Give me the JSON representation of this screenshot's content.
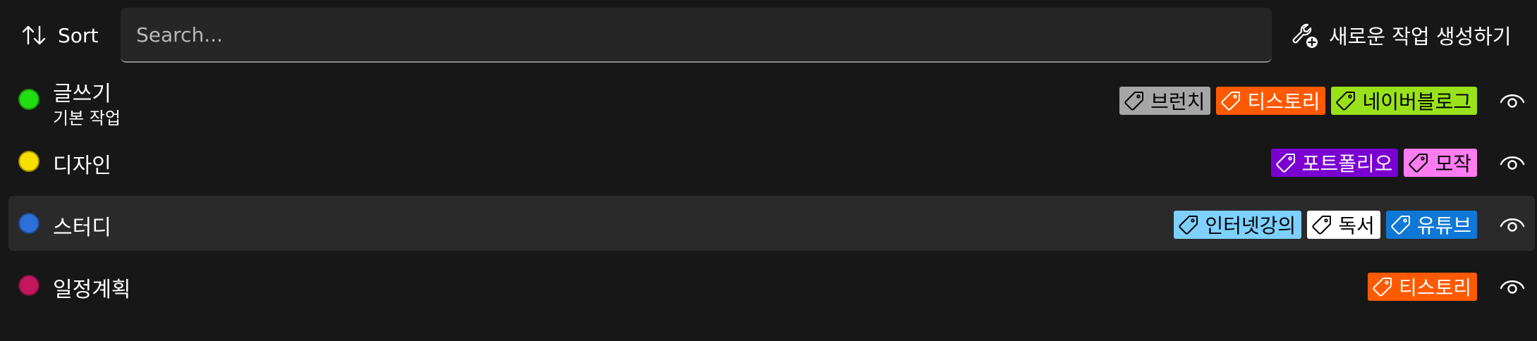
{
  "toolbar": {
    "sort_label": "Sort",
    "search_placeholder": "Search...",
    "search_value": "",
    "new_task_label": "새로운 작업 생성하기",
    "sort_icon": "sort-arrows-icon",
    "new_task_icon": "wrench-add-icon"
  },
  "tasks": [
    {
      "name": "글쓰기",
      "subtitle": "기본 작업",
      "color": "#22dd11",
      "highlighted": false,
      "tags": [
        {
          "label": "브런치",
          "bg": "#a6a6a6",
          "fg": "#000000"
        },
        {
          "label": "티스토리",
          "bg": "#ff5a00",
          "fg": "#ffffff"
        },
        {
          "label": "네이버블로그",
          "bg": "#99e21a",
          "fg": "#000000"
        }
      ]
    },
    {
      "name": "디자인",
      "subtitle": "",
      "color": "#f7e000",
      "highlighted": false,
      "tags": [
        {
          "label": "포트폴리오",
          "bg": "#7a00d2",
          "fg": "#ffffff"
        },
        {
          "label": "모작",
          "bg": "#ff7cf0",
          "fg": "#000000"
        }
      ]
    },
    {
      "name": "스터디",
      "subtitle": "",
      "color": "#2d6fd9",
      "highlighted": true,
      "tags": [
        {
          "label": "인터넷강의",
          "bg": "#7dd0ff",
          "fg": "#000000"
        },
        {
          "label": "독서",
          "bg": "#ffffff",
          "fg": "#000000"
        },
        {
          "label": "유튜브",
          "bg": "#0f78d6",
          "fg": "#ffffff"
        }
      ]
    },
    {
      "name": "일정계획",
      "subtitle": "",
      "color": "#c2185b",
      "highlighted": false,
      "tags": [
        {
          "label": "티스토리",
          "bg": "#ff5a00",
          "fg": "#ffffff"
        }
      ]
    }
  ],
  "icons": {
    "tag": "tag-icon",
    "visibility": "eye-icon"
  }
}
